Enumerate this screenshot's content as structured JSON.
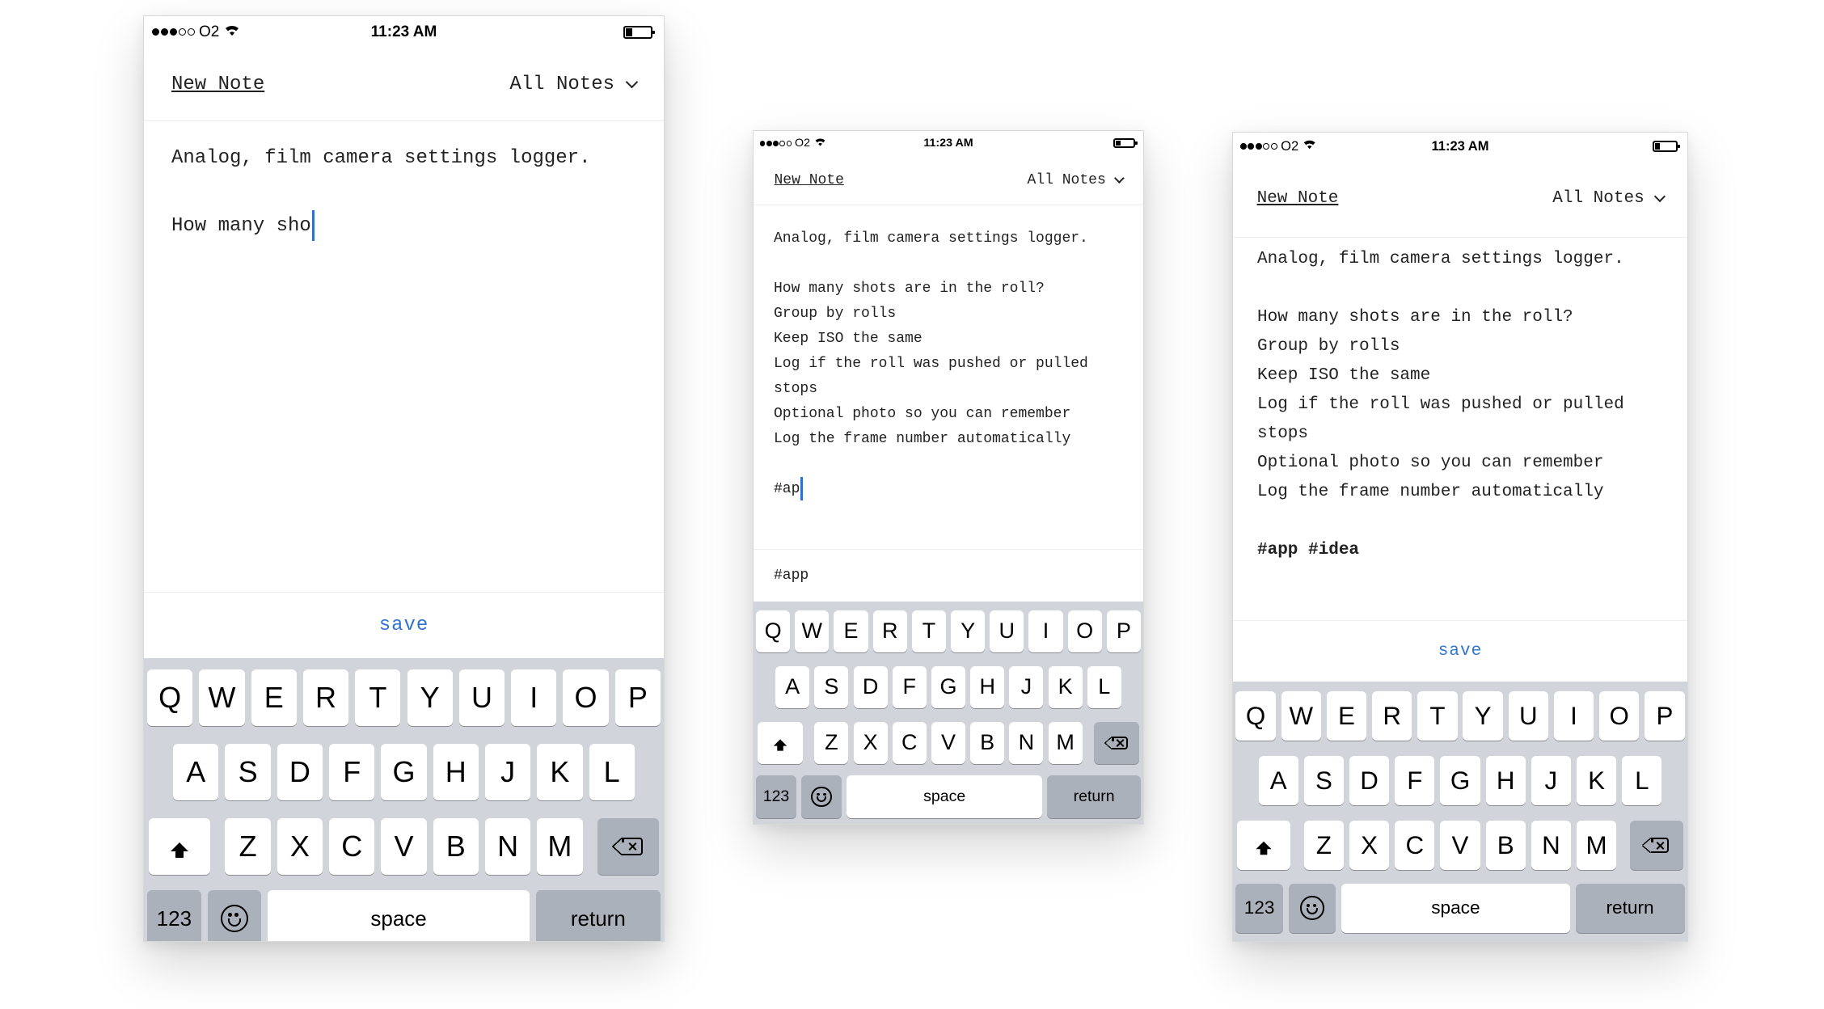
{
  "status_bar": {
    "carrier": "O2",
    "time": "11:23 AM"
  },
  "header": {
    "new_note": "New Note",
    "all_notes": "All Notes"
  },
  "phone1": {
    "lines": [
      "Analog, film camera settings logger.",
      "",
      "How many sho"
    ]
  },
  "phone2": {
    "lines": [
      "Analog, film camera settings logger.",
      "",
      "How many shots are in the roll?",
      "Group by rolls",
      "Keep ISO the same",
      "Log if the roll was pushed or pulled",
      "stops",
      "Optional photo so you can remember",
      "Log the frame number automatically",
      "",
      "#ap"
    ],
    "tag_suggestion": "#app"
  },
  "phone3": {
    "lines": [
      "Analog, film camera settings logger.",
      "",
      "How many shots are in the roll?",
      "Group by rolls",
      "Keep ISO the same",
      "Log if the roll was pushed or pulled",
      "stops",
      "Optional photo so you can remember",
      "Log the frame number automatically",
      "",
      "#app #idea"
    ]
  },
  "save_label": "save",
  "keyboard": {
    "row1": [
      "Q",
      "W",
      "E",
      "R",
      "T",
      "Y",
      "U",
      "I",
      "O",
      "P"
    ],
    "row2": [
      "A",
      "S",
      "D",
      "F",
      "G",
      "H",
      "J",
      "K",
      "L"
    ],
    "row3": [
      "Z",
      "X",
      "C",
      "V",
      "B",
      "N",
      "M"
    ],
    "numbers": "123",
    "space": "space",
    "return": "return"
  },
  "icons": [
    "signal-dots-icon",
    "wifi-icon",
    "battery-icon",
    "chevron-down-icon",
    "shift-icon",
    "backspace-icon",
    "emoji-icon"
  ]
}
